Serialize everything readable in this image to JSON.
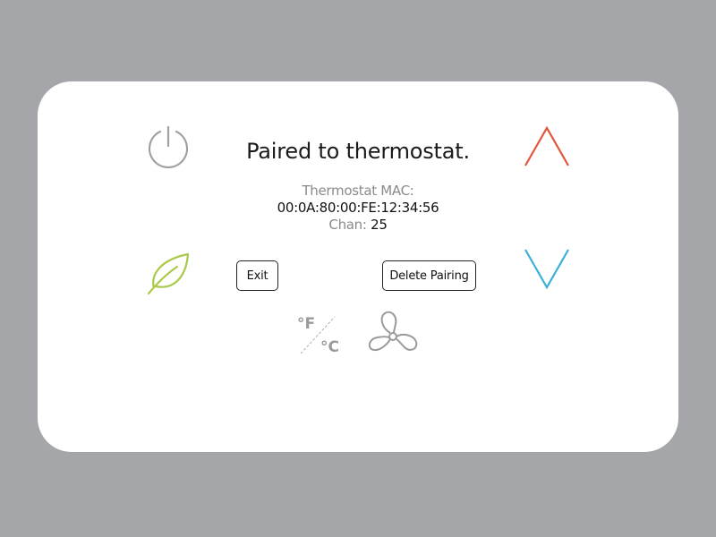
{
  "screen": {
    "title": "Paired to thermostat.",
    "mac_label": "Thermostat MAC:",
    "mac_value": "00:0A:80:00:FE:12:34:56",
    "chan_label": "Chan:",
    "chan_value": "25"
  },
  "buttons": {
    "exit_label": "Exit",
    "delete_label": "Delete Pairing"
  },
  "units": {
    "fahrenheit": "°F",
    "celsius": "°C"
  },
  "icons": {
    "power": "power-icon",
    "leaf": "leaf-icon",
    "up": "chevron-up-icon",
    "down": "chevron-down-icon",
    "fan": "fan-icon",
    "unit_toggle": "temperature-unit-icon"
  },
  "colors": {
    "background": "#a5a6a9",
    "panel": "#ffffff",
    "up_arrow": "#e2553a",
    "down_arrow": "#3ab0d8",
    "leaf": "#a9c94a",
    "icon_gray": "#9a9a9a"
  }
}
